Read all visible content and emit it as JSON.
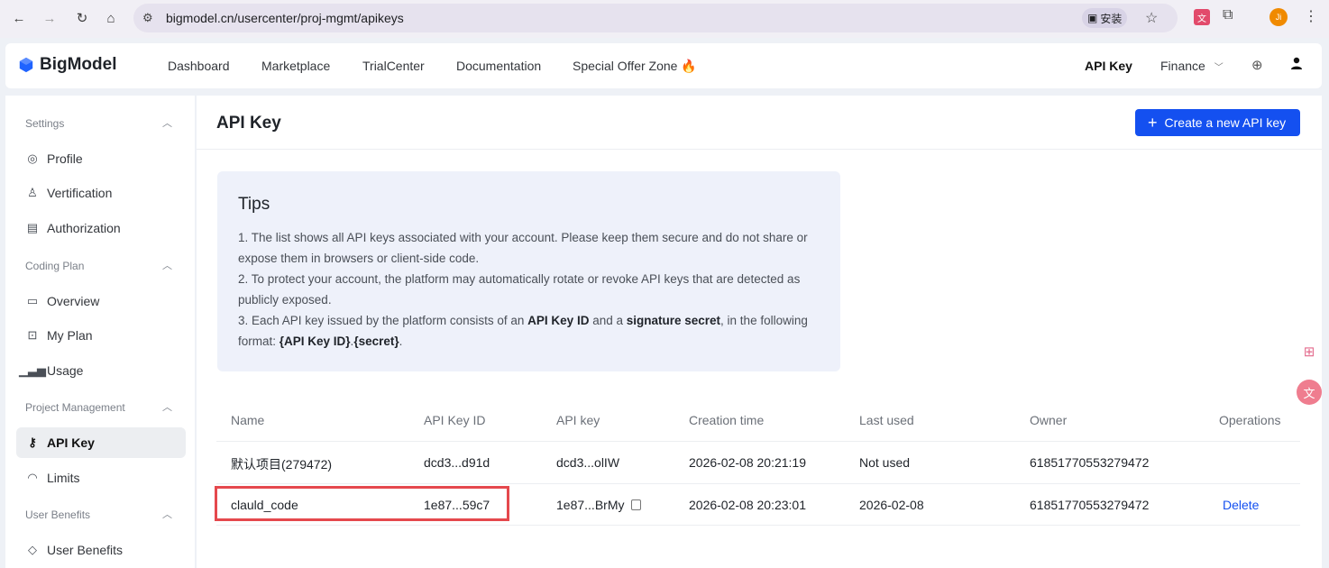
{
  "browser": {
    "url": "bigmodel.cn/usercenter/proj-mgmt/apikeys",
    "install_label": "安装",
    "profile_initial": "Ji"
  },
  "nav": {
    "logo": "BigModel",
    "links": [
      "Dashboard",
      "Marketplace",
      "TrialCenter",
      "Documentation",
      "Special Offer Zone"
    ],
    "api_key": "API Key",
    "finance": "Finance",
    "flame": "🔥"
  },
  "sidebar": {
    "sections": [
      {
        "title": "Settings",
        "items": [
          "Profile",
          "Vertification",
          "Authorization"
        ]
      },
      {
        "title": "Coding Plan",
        "items": [
          "Overview",
          "My Plan",
          "Usage"
        ]
      },
      {
        "title": "Project Management",
        "items": [
          "API Key",
          "Limits"
        ]
      },
      {
        "title": "User Benefits",
        "items": [
          "User Benefits"
        ]
      }
    ],
    "active_item": "API Key"
  },
  "main": {
    "title": "API Key",
    "create_button": "Create a new API key",
    "tips": {
      "title": "Tips",
      "line1": "1. The list shows all API keys associated with your account. Please keep them secure and do not share or expose them in browsers or client-side code.",
      "line2": "2. To protect your account, the platform may automatically rotate or revoke API keys that are detected as publicly exposed.",
      "line3_a": "3. Each API key issued by the platform consists of an ",
      "line3_b": "API Key ID",
      "line3_c": " and a ",
      "line3_d": "signature secret",
      "line3_e": ", in the following format: ",
      "line3_f": "{API Key ID}",
      "line3_g": ".",
      "line3_h": "{secret}",
      "line3_i": "."
    },
    "table": {
      "headers": [
        "Name",
        "API Key ID",
        "API key",
        "Creation time",
        "Last used",
        "Owner",
        "Operations"
      ],
      "rows": [
        {
          "name": "默认项目(279472)",
          "key_id": "dcd3...d91d",
          "api_key": "dcd3...olIW",
          "created": "2026-02-08 20:21:19",
          "last_used": "Not used",
          "owner": "61851770553279472",
          "operation": ""
        },
        {
          "name": "clauld_code",
          "key_id": "1e87...59c7",
          "api_key": "1e87...BrMy",
          "created": "2026-02-08 20:23:01",
          "last_used": "2026-02-08",
          "owner": "61851770553279472",
          "operation": "Delete"
        }
      ]
    }
  },
  "colors": {
    "accent": "#1450f0",
    "highlight": "#e5484d"
  }
}
